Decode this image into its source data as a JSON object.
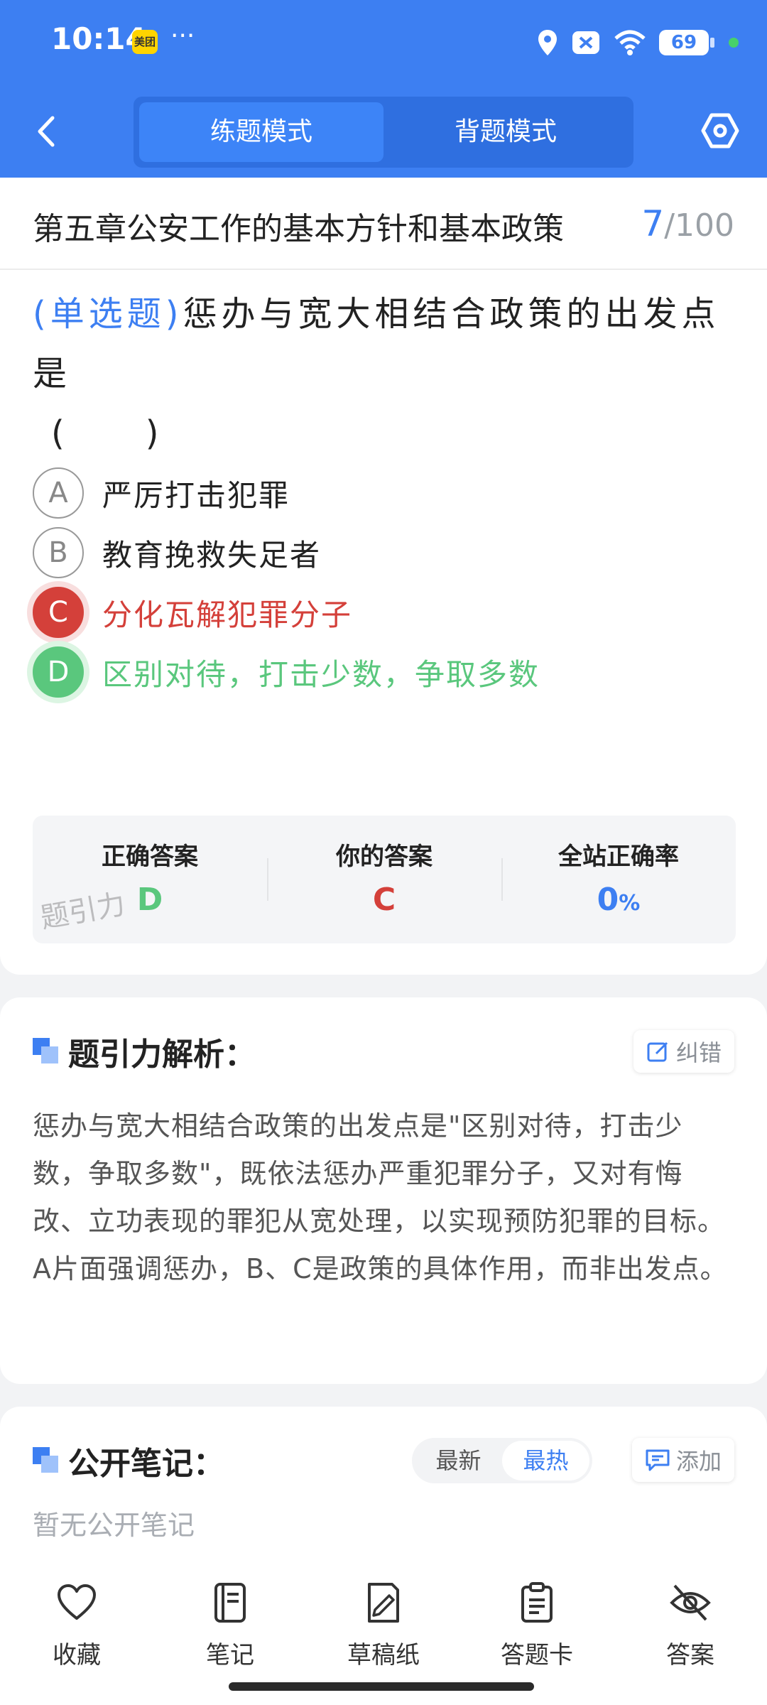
{
  "status_bar": {
    "time": "10:14",
    "app_badge": "美团",
    "more": "···",
    "battery": "69"
  },
  "header": {
    "mode_tabs": [
      {
        "label": "练题模式",
        "active": true
      },
      {
        "label": "背题模式",
        "active": false
      }
    ]
  },
  "chapter": {
    "title": "第五章公安工作的基本方针和基本政策",
    "current": "7",
    "total": "/100"
  },
  "question": {
    "type": "(单选题)",
    "text": "惩办与宽大相结合政策的出发点是",
    "blank": "(　　)"
  },
  "options": [
    {
      "letter": "A",
      "text": "严厉打击犯罪",
      "state": "normal"
    },
    {
      "letter": "B",
      "text": "教育挽救失足者",
      "state": "normal"
    },
    {
      "letter": "C",
      "text": "分化瓦解犯罪分子",
      "state": "wrong"
    },
    {
      "letter": "D",
      "text": "区别对待，打击少数，争取多数",
      "state": "correct"
    }
  ],
  "answer_summary": {
    "correct_label": "正确答案",
    "correct_value": "D",
    "yours_label": "你的答案",
    "yours_value": "C",
    "rate_label": "全站正确率",
    "rate_value": "0",
    "rate_unit": "%",
    "watermark": "题引力"
  },
  "analysis": {
    "title": "题引力解析：",
    "fix_label": "纠错",
    "text": "惩办与宽大相结合政策的出发点是\"区别对待，打击少数，争取多数\"，既依法惩办严重犯罪分子，又对有悔改、立功表现的罪犯从宽处理，以实现预防犯罪的目标。A片面强调惩办，B、C是政策的具体作用，而非出发点。"
  },
  "notes": {
    "title": "公开笔记：",
    "sort_newest": "最新",
    "sort_hottest": "最热",
    "add_label": "添加",
    "empty_text": "暂无公开笔记"
  },
  "bottom_nav": [
    {
      "label": "收藏",
      "icon": "heart-icon"
    },
    {
      "label": "笔记",
      "icon": "notebook-icon"
    },
    {
      "label": "草稿纸",
      "icon": "draft-paper-icon"
    },
    {
      "label": "答题卡",
      "icon": "answer-sheet-icon"
    },
    {
      "label": "答案",
      "icon": "eye-off-icon"
    }
  ],
  "colors": {
    "primary": "#3d7ff2",
    "correct": "#5ac77d",
    "wrong": "#d4403a"
  }
}
